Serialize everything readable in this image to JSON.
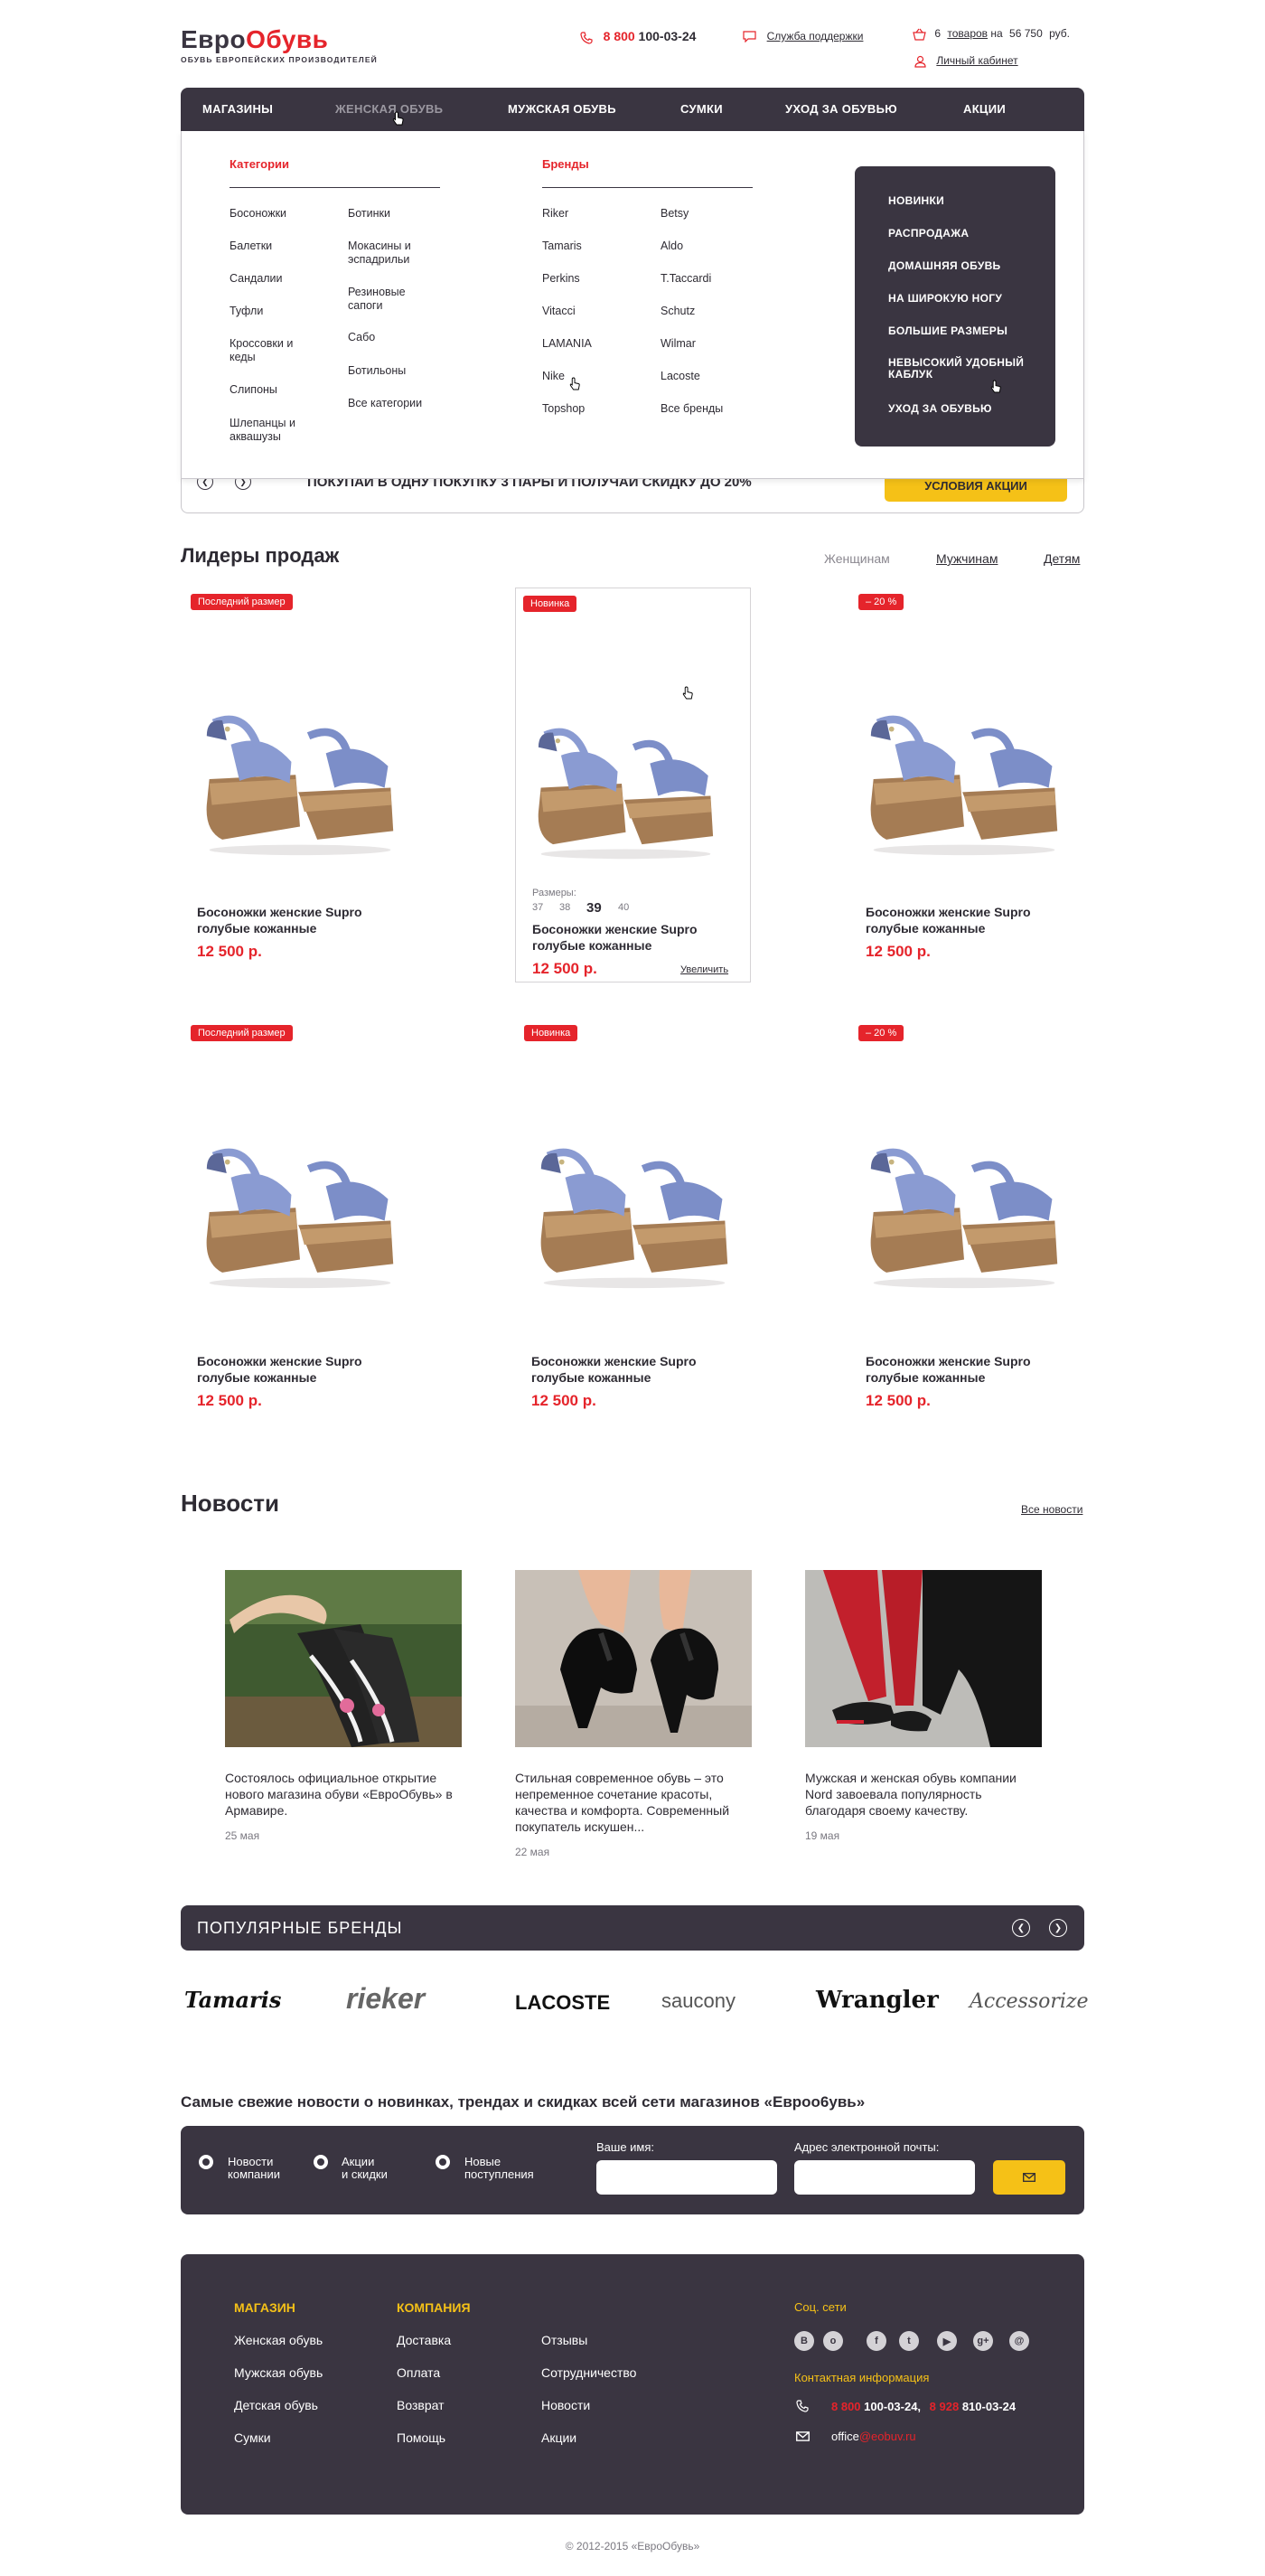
{
  "brand": {
    "name_part1": "Евро",
    "name_part2": "Обувь",
    "tagline": "ОБУВЬ ЕВРОПЕЙСКИХ ПРОИЗВОДИТЕЛЕЙ"
  },
  "header": {
    "phone_prefix": "8 ",
    "phone_code": "800",
    "phone_number": " 100-03-24",
    "support": "Служба поддержки",
    "cart_count": "6",
    "cart_label": "товаров",
    "cart_on": "на",
    "cart_sum": "56 750",
    "cart_currency": "руб.",
    "account": "Личный кабинет"
  },
  "nav": {
    "items": [
      "МАГАЗИНЫ",
      "ЖЕНСКАЯ ОБУВЬ",
      "МУЖСКАЯ ОБУВЬ",
      "СУМКИ",
      "УХОД ЗА ОБУВЬЮ",
      "АКЦИИ"
    ]
  },
  "mega": {
    "cat_title": "Категории",
    "cat_col1": [
      "Босоножки",
      "Балетки",
      "Сандалии",
      "Туфли",
      "Кроссовки и кеды",
      "Слипоны",
      "Шлепанцы и аквашузы"
    ],
    "cat_col2": [
      "Ботинки",
      "Мокасины и эспадрильи",
      "Резиновые сапоги",
      "Сабо",
      "Ботильоны",
      "Все категории"
    ],
    "brand_title": "Бренды",
    "brand_col1": [
      "Riker",
      "Tamaris",
      "Perkins",
      "Vitacci",
      "LAMANIA",
      "Nike",
      "Topshop"
    ],
    "brand_col2": [
      "Betsy",
      "Aldo",
      "T.Taccardi",
      "Schutz",
      "Wilmar",
      "Lacoste",
      "Все бренды"
    ],
    "dark": [
      "НОВИНКИ",
      "РАСПРОДАЖА",
      "ДОМАШНЯЯ ОБУВЬ",
      "НА ШИРОКУЮ НОГУ",
      "БОЛЬШИЕ РАЗМЕРЫ",
      "НЕВЫСОКИЙ УДОБНЫЙ КАБЛУК",
      "УХОД ЗА ОБУВЬЮ"
    ]
  },
  "promo": {
    "text": "ПОКУПАЙ В ОДНУ ПОКУПКУ 3 ПАРЫ И ПОЛУЧАЙ СКИДКУ ДО 20%",
    "button": "УСЛОВИЯ АКЦИИ"
  },
  "leaders": {
    "title": "Лидеры продаж",
    "tabs": [
      "Женщинам",
      "Мужчинам",
      "Детям"
    ],
    "products": [
      {
        "badge": "Последний размер",
        "name": "Босоножки женские Supro голубые кожанные",
        "price": "12 500 р."
      },
      {
        "badge": "Новинка",
        "name": "Босоножки женские Supro голубые кожанные",
        "price": "12 500 р.",
        "sizes_label": "Размеры:",
        "sizes": [
          "37",
          "38",
          "39",
          "40"
        ],
        "zoom": "Увеличить"
      },
      {
        "badge": "– 20 %",
        "name": "Босоножки женские Supro голубые кожанные",
        "price": "12 500 р."
      },
      {
        "badge": "Последний размер",
        "name": "Босоножки женские Supro голубые кожанные",
        "price": "12 500 р."
      },
      {
        "badge": "Новинка",
        "name": "Босоножки женские Supro голубые кожанные",
        "price": "12 500 р."
      },
      {
        "badge": "– 20 %",
        "name": "Босоножки женские Supro голубые кожанные",
        "price": "12 500 р."
      }
    ]
  },
  "news": {
    "title": "Новости",
    "all": "Все новости",
    "items": [
      {
        "text": "Состоялось официальное открытие нового магазина обуви «ЕвроОбувь» в Армавире.",
        "date": "25 мая"
      },
      {
        "text": "Стильная современное обувь – это непременное сочетание красоты, качества и комфорта. Современный покупатель искушен...",
        "date": "22 мая"
      },
      {
        "text": "Мужская и женская обувь компании Nord завоевала популярность благодаря своему качеству.",
        "date": "19 мая"
      }
    ]
  },
  "brands": {
    "title": "ПОПУЛЯРНЫЕ БРЕНДЫ",
    "logos": [
      "Tamaris",
      "rieker",
      "LACOSTE",
      "saucony",
      "Wrangler",
      "Accessorize"
    ]
  },
  "subscribe": {
    "title": "Самые свежие новости о новинках, трендах и скидках всей сети магазинов «Евроо6увь»",
    "options": [
      [
        "Новости",
        "компании"
      ],
      [
        "Акции",
        "и скидки"
      ],
      [
        "Новые",
        "поступления"
      ]
    ],
    "name_label": "Ваше имя:",
    "email_label": "Адрес электронной почты:"
  },
  "footer": {
    "shop_title": "МАГАЗИН",
    "shop": [
      "Женская обувь",
      "Мужская обувь",
      "Детская обувь",
      "Сумки"
    ],
    "company_title": "КОМПАНИЯ",
    "company1": [
      "Доставка",
      "Оплата",
      "Возврат",
      "Помощь"
    ],
    "company2": [
      "Отзывы",
      "Сотрудничество",
      "Новости",
      "Акции"
    ],
    "social_title": "Соц. сети",
    "social": [
      "В",
      "о",
      "f",
      "t",
      "▶",
      "g+",
      "@"
    ],
    "contact_title": "Контактная информация",
    "phone1_code": "8 800",
    "phone1": " 100-03-24,",
    "phone2_code": "8 928",
    "phone2": " 810-03-24",
    "email_user": "office",
    "email_domain": "@eobuv.ru"
  },
  "copyright": "© 2012-2015 «ЕвроОбувь»"
}
